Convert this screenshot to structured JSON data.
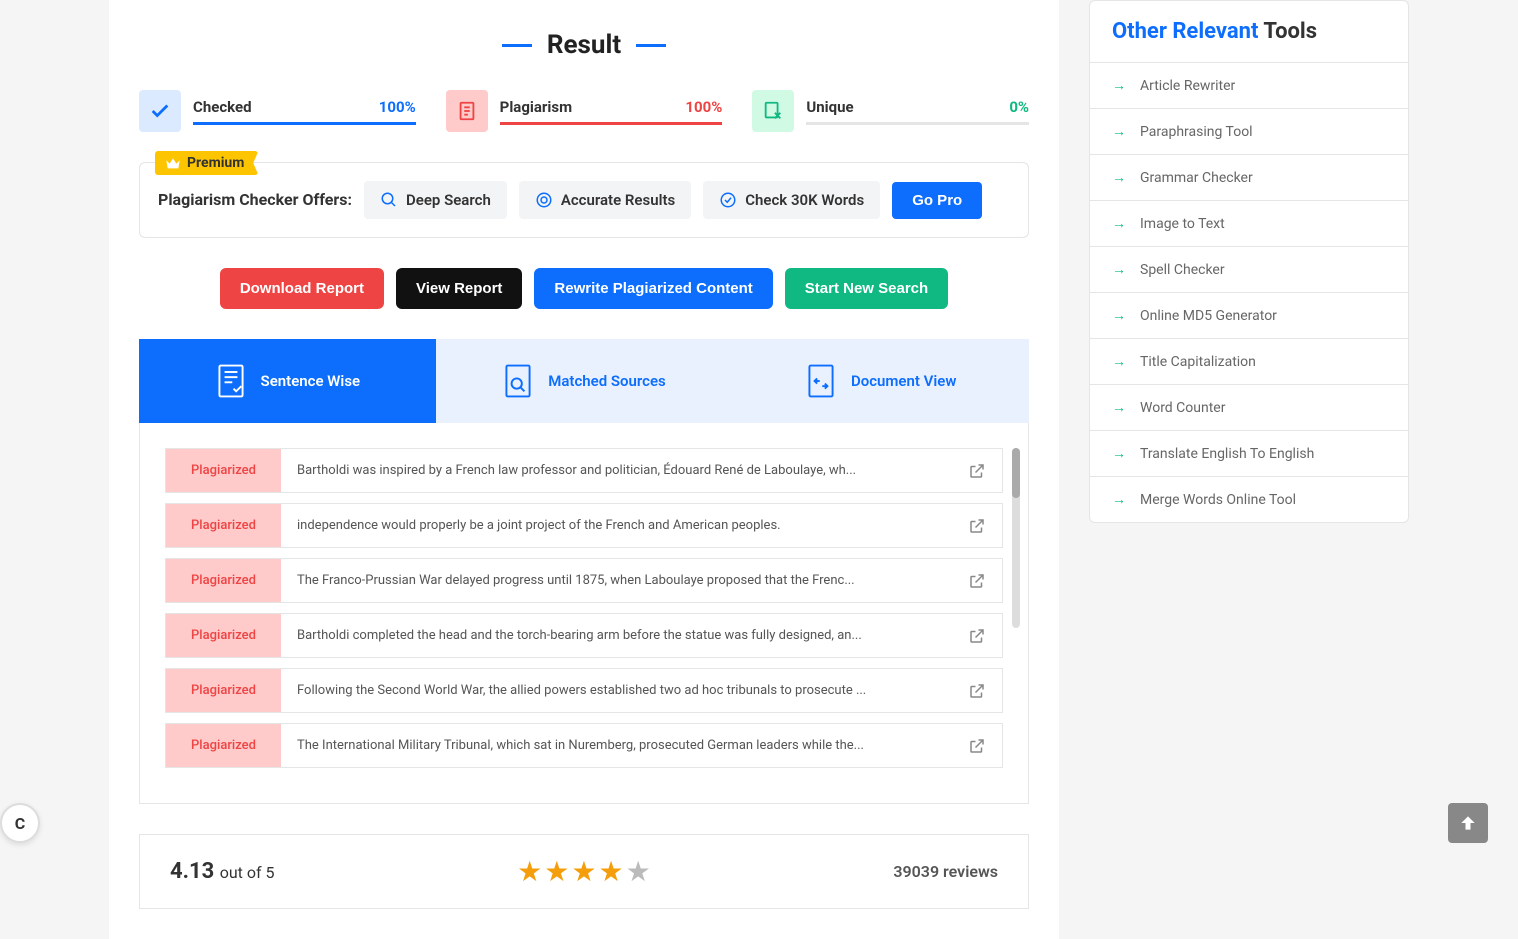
{
  "header": {
    "title": "Result"
  },
  "stats": {
    "checked": {
      "label": "Checked",
      "value": "100%",
      "fill": 100,
      "color": "#0d6efd"
    },
    "plagiarism": {
      "label": "Plagiarism",
      "value": "100%",
      "fill": 100,
      "color": "#ef4444"
    },
    "unique": {
      "label": "Unique",
      "value": "0%",
      "fill": 0,
      "color": "#10b981"
    }
  },
  "premium": {
    "badge": "Premium",
    "title": "Plagiarism Checker Offers:",
    "features": [
      "Deep Search",
      "Accurate Results",
      "Check 30K Words"
    ],
    "cta": "Go Pro"
  },
  "actions": {
    "download": "Download Report",
    "view": "View Report",
    "rewrite": "Rewrite Plagiarized Content",
    "new_search": "Start New Search"
  },
  "tabs": {
    "sentence": "Sentence Wise",
    "matched": "Matched Sources",
    "document": "Document View"
  },
  "sentences": [
    {
      "status": "Plagiarized",
      "text": "Bartholdi was inspired by a French law professor and politician, Édouard René de Laboulaye, wh..."
    },
    {
      "status": "Plagiarized",
      "text": "independence would properly be a joint project of the French and American peoples."
    },
    {
      "status": "Plagiarized",
      "text": "The Franco-Prussian War delayed progress until 1875, when Laboulaye proposed that the Frenc..."
    },
    {
      "status": "Plagiarized",
      "text": "Bartholdi completed the head and the torch-bearing arm before the statue was fully designed, an..."
    },
    {
      "status": "Plagiarized",
      "text": "Following the Second World War, the allied powers established two ad hoc tribunals to prosecute ..."
    },
    {
      "status": "Plagiarized",
      "text": "The International Military Tribunal, which sat in Nuremberg, prosecuted German leaders while the..."
    }
  ],
  "rating": {
    "score": "4.13",
    "out": "out of 5",
    "reviews": "39039 reviews"
  },
  "sidebar": {
    "title_blue": "Other Relevant",
    "title_black": "Tools",
    "items": [
      "Article Rewriter",
      "Paraphrasing Tool",
      "Grammar Checker",
      "Image to Text",
      "Spell Checker",
      "Online MD5 Generator",
      "Title Capitalization",
      "Word Counter",
      "Translate English To English",
      "Merge Words Online Tool"
    ]
  }
}
